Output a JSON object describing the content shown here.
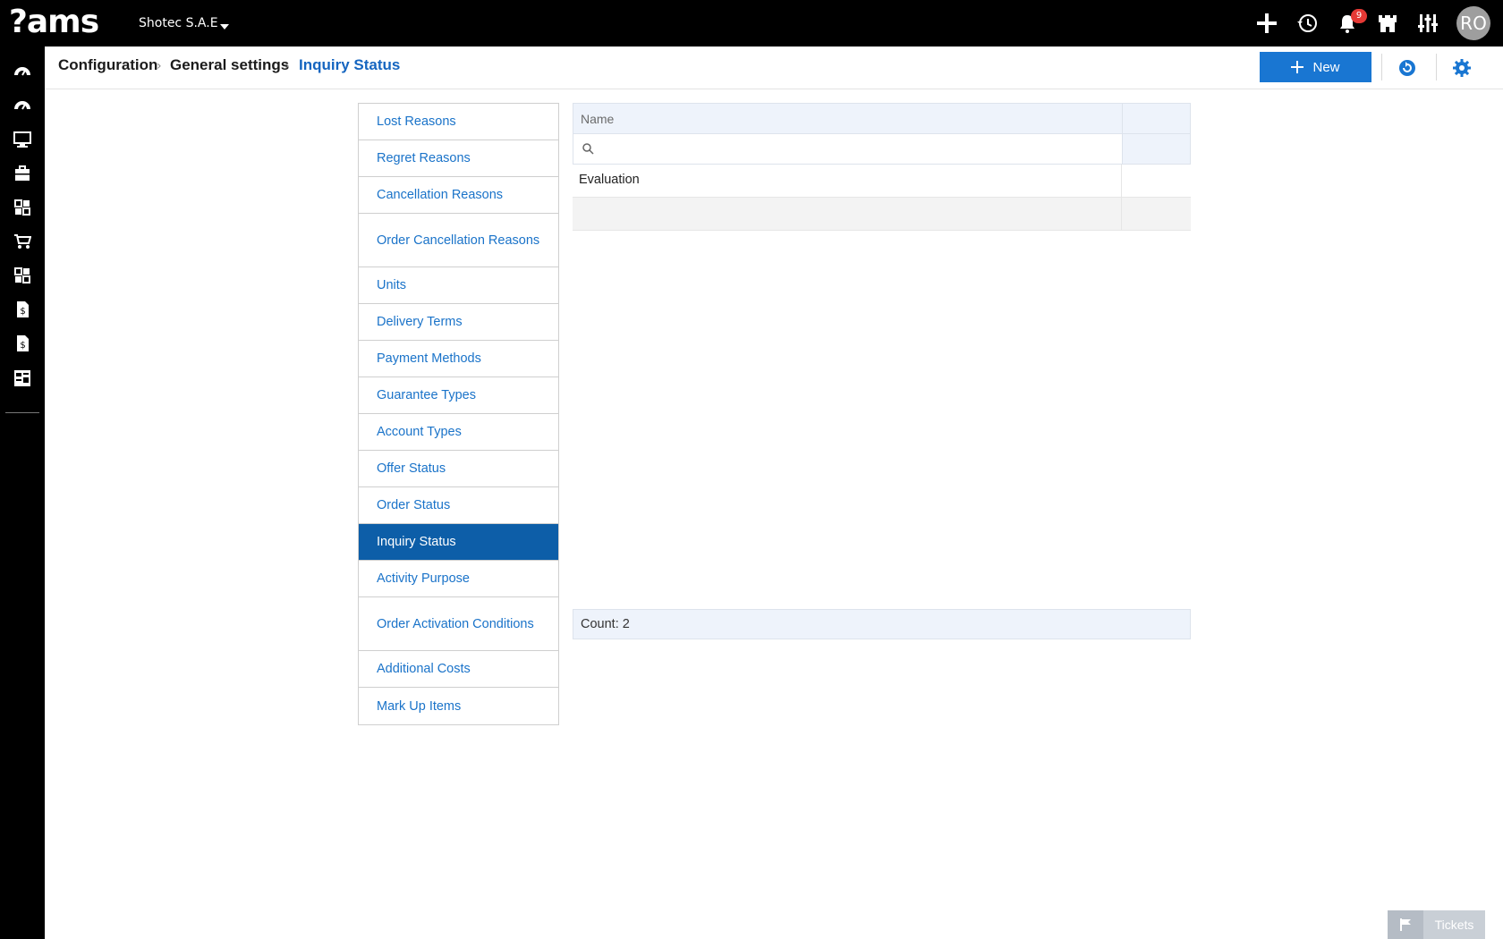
{
  "app": {
    "logo_text": "?ams",
    "company": "Shotec S.A.E",
    "notification_count": "9",
    "avatar_initials": "RO"
  },
  "sidebar": {
    "icons": [
      "dashboard-icon",
      "dashboard-alt-icon",
      "monitor-icon",
      "briefcase-icon",
      "modules-icon",
      "cart-icon",
      "modules-alt-icon",
      "invoice-icon",
      "invoice-alt-icon",
      "reports-icon"
    ]
  },
  "breadcrumb": {
    "items": [
      "Configuration",
      "General settings",
      "Inquiry Status"
    ]
  },
  "toolbar": {
    "new_label": "New"
  },
  "menu": {
    "items": [
      "Lost Reasons",
      "Regret Reasons",
      "Cancellation Reasons",
      "Order Cancellation Reasons",
      "Units",
      "Delivery Terms",
      "Payment Methods",
      "Guarantee Types",
      "Account Types",
      "Offer Status",
      "Order Status",
      "Inquiry Status",
      "Activity Purpose",
      "Order Activation Conditions",
      "Additional Costs",
      "Mark Up Items"
    ],
    "selected_index": 11
  },
  "grid": {
    "column_name": "Name",
    "filter_placeholder": "",
    "rows": [
      "Evaluation",
      ""
    ],
    "footer": "Count: 2"
  },
  "tickets": {
    "label": "Tickets"
  },
  "colors": {
    "accent": "#1976d2",
    "selected": "#0d5ea8",
    "link": "#1a73c9"
  }
}
